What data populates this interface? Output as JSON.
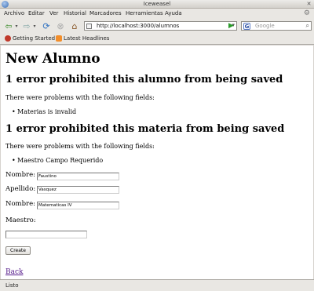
{
  "window": {
    "title": "Iceweasel"
  },
  "menubar": [
    "Archivo",
    "Editar",
    "Ver",
    "Historial",
    "Marcadores",
    "Herramientas",
    "Ayuda"
  ],
  "navbar": {
    "url": "http://localhost:3000/alumnos",
    "search_placeholder": "Google"
  },
  "bookmarks": [
    "Getting Started",
    "Latest Headlines"
  ],
  "page": {
    "title": "New Alumno",
    "errors": [
      {
        "heading": "1 error prohibited this alumno from being saved",
        "intro": "There were problems with the following fields:",
        "items": [
          "Materias is invalid"
        ]
      },
      {
        "heading": "1 error prohibited this materia from being saved",
        "intro": "There were problems with the following fields:",
        "items": [
          "Maestro Campo Requerido"
        ]
      }
    ],
    "form": {
      "nombre_label": "Nombre:",
      "nombre_value": "Faustino",
      "apellido_label": "Apellido:",
      "apellido_value": "Vasquez",
      "materia_label": "Nombre:",
      "materia_value": "Matematicas IV",
      "maestro_label": "Maestro:",
      "maestro_value": "",
      "submit": "Create"
    },
    "back_link": "Back"
  },
  "status": "Listo",
  "colors": {
    "link_visited": "#551a8b",
    "chrome": "#e9e7e3"
  }
}
